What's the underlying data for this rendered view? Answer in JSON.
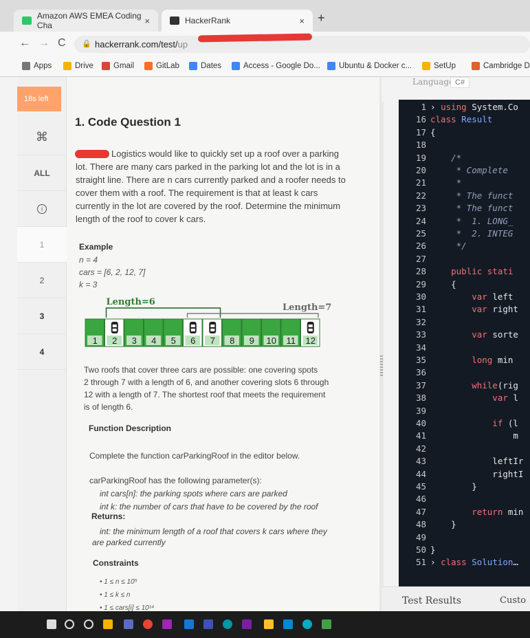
{
  "browser": {
    "tabs": [
      {
        "label": "Amazon AWS EMEA Coding Cha",
        "close": "×"
      },
      {
        "label": "HackerRank",
        "close": "×"
      }
    ],
    "new_tab": "+",
    "nav": {
      "back": "←",
      "forward": "→",
      "reload": "C"
    },
    "url": "hackerrank.com/test/",
    "url_tail": "up",
    "bookmarks": [
      "Apps",
      "Drive",
      "Gmail",
      "GitLab",
      "Dates",
      "Access - Google Do...",
      "Ubuntu & Docker c...",
      "SetUp",
      "Cambridge D"
    ]
  },
  "rail": {
    "time_left": "18s left",
    "items": [
      "⌘",
      "ALL",
      "i",
      "1",
      "2",
      "3",
      "4"
    ]
  },
  "problem": {
    "title": "1. Code Question 1",
    "intro": [
      "Logistics would like to quickly set up a roof over a parking",
      "lot. There are many cars parked in the parking lot and the lot is in a",
      "straight line. There are n cars currently parked and a roofer needs to",
      "cover them with a roof. The requirement is that at least k cars",
      "currently in the lot are covered by the roof. Determine the minimum",
      "length of the roof to cover k cars."
    ],
    "example_heading": "Example",
    "example_lines": [
      "n = 4",
      "cars = [6, 2, 12, 7]",
      "k = 3"
    ],
    "diagram": {
      "label_left": "Length=6",
      "label_right": "Length=7",
      "spots": [
        "1",
        "2",
        "3",
        "4",
        "5",
        "6",
        "7",
        "8",
        "9",
        "10",
        "11",
        "12"
      ],
      "cars_at": [
        2,
        6,
        7,
        12
      ]
    },
    "explanation": [
      "Two roofs that cover three cars are possible: one covering spots",
      "2 through 7 with a length of 6, and another covering slots 6 through",
      "12 with a length of 7.  The shortest roof that meets the requirement",
      "is of length 6."
    ],
    "func_heading": "Function Description",
    "func_text": "Complete the function carParkingRoof in the editor below.",
    "params_intro": "carParkingRoof has the following parameter(s):",
    "param1": "int cars[n]: the parking spots where cars are parked",
    "param2": "int k: the number of cars that have to be covered by the roof",
    "returns_heading": "Returns:",
    "returns_line1": "int: the minimum length of a roof that covers k cars where they",
    "returns_line2": "are parked currently",
    "constraints_heading": "Constraints",
    "constraints": [
      "1 ≤ n ≤ 10⁵",
      "1 ≤ k ≤ n",
      "1 ≤ cars[i] ≤ 10¹⁴"
    ]
  },
  "editor": {
    "language_label": "Language",
    "language_value": "C#",
    "lines": [
      {
        "n": "1",
        "parts": [
          {
            "c": "tx",
            "t": "› "
          },
          {
            "c": "kw",
            "t": "using"
          },
          {
            "c": "tx",
            "t": " System.Co"
          }
        ]
      },
      {
        "n": "16",
        "parts": [
          {
            "c": "kw",
            "t": "class"
          },
          {
            "c": "ty",
            "t": " Result"
          }
        ]
      },
      {
        "n": "17",
        "parts": [
          {
            "c": "tx",
            "t": "{"
          }
        ]
      },
      {
        "n": "18",
        "parts": []
      },
      {
        "n": "19",
        "parts": [
          {
            "c": "cm",
            "t": "    /*"
          }
        ]
      },
      {
        "n": "20",
        "parts": [
          {
            "c": "cm",
            "t": "     * Complete"
          }
        ]
      },
      {
        "n": "21",
        "parts": [
          {
            "c": "cm",
            "t": "     *"
          }
        ]
      },
      {
        "n": "22",
        "parts": [
          {
            "c": "cm",
            "t": "     * The funct"
          }
        ]
      },
      {
        "n": "23",
        "parts": [
          {
            "c": "cm",
            "t": "     * The funct"
          }
        ]
      },
      {
        "n": "24",
        "parts": [
          {
            "c": "cm",
            "t": "     *  1. LONG_"
          }
        ]
      },
      {
        "n": "25",
        "parts": [
          {
            "c": "cm",
            "t": "     *  2. INTEG"
          }
        ]
      },
      {
        "n": "26",
        "parts": [
          {
            "c": "cm",
            "t": "     */"
          }
        ]
      },
      {
        "n": "27",
        "parts": []
      },
      {
        "n": "28",
        "parts": [
          {
            "c": "kw",
            "t": "    public stati"
          }
        ]
      },
      {
        "n": "29",
        "parts": [
          {
            "c": "tx",
            "t": "    {"
          }
        ]
      },
      {
        "n": "30",
        "parts": [
          {
            "c": "kw",
            "t": "        var"
          },
          {
            "c": "tx",
            "t": " left"
          }
        ]
      },
      {
        "n": "31",
        "parts": [
          {
            "c": "kw",
            "t": "        var"
          },
          {
            "c": "tx",
            "t": " right"
          }
        ]
      },
      {
        "n": "32",
        "parts": []
      },
      {
        "n": "33",
        "parts": [
          {
            "c": "kw",
            "t": "        var"
          },
          {
            "c": "tx",
            "t": " sorte"
          }
        ]
      },
      {
        "n": "34",
        "parts": []
      },
      {
        "n": "35",
        "parts": [
          {
            "c": "kw",
            "t": "        long"
          },
          {
            "c": "tx",
            "t": " min"
          }
        ]
      },
      {
        "n": "36",
        "parts": []
      },
      {
        "n": "37",
        "parts": [
          {
            "c": "kw",
            "t": "        while"
          },
          {
            "c": "tx",
            "t": "(rig"
          }
        ]
      },
      {
        "n": "38",
        "parts": [
          {
            "c": "kw",
            "t": "            var"
          },
          {
            "c": "tx",
            "t": " l"
          }
        ]
      },
      {
        "n": "39",
        "parts": []
      },
      {
        "n": "40",
        "parts": [
          {
            "c": "kw",
            "t": "            if"
          },
          {
            "c": "tx",
            "t": " (l"
          }
        ]
      },
      {
        "n": "41",
        "parts": [
          {
            "c": "tx",
            "t": "                m"
          }
        ]
      },
      {
        "n": "42",
        "parts": []
      },
      {
        "n": "43",
        "parts": [
          {
            "c": "tx",
            "t": "            leftIr"
          }
        ]
      },
      {
        "n": "44",
        "parts": [
          {
            "c": "tx",
            "t": "            rightI"
          }
        ]
      },
      {
        "n": "45",
        "parts": [
          {
            "c": "tx",
            "t": "        }"
          }
        ]
      },
      {
        "n": "46",
        "parts": []
      },
      {
        "n": "47",
        "parts": [
          {
            "c": "kw",
            "t": "        return"
          },
          {
            "c": "tx",
            "t": " min"
          }
        ]
      },
      {
        "n": "48",
        "parts": [
          {
            "c": "tx",
            "t": "    }"
          }
        ]
      },
      {
        "n": "49",
        "parts": []
      },
      {
        "n": "50",
        "parts": [
          {
            "c": "tx",
            "t": "}"
          }
        ]
      },
      {
        "n": "51",
        "parts": [
          {
            "c": "tx",
            "t": "› "
          },
          {
            "c": "kw",
            "t": "class"
          },
          {
            "c": "ty",
            "t": " Solution"
          },
          {
            "c": "tx",
            "t": "…"
          }
        ]
      }
    ],
    "test_results": "Test Results",
    "custom": "Custo"
  },
  "colors": {
    "accent": "#ffa26b",
    "editor_bg": "#141a24",
    "keyword": "#f07178",
    "type": "#82aaff",
    "spot_green": "#3aa63f"
  }
}
